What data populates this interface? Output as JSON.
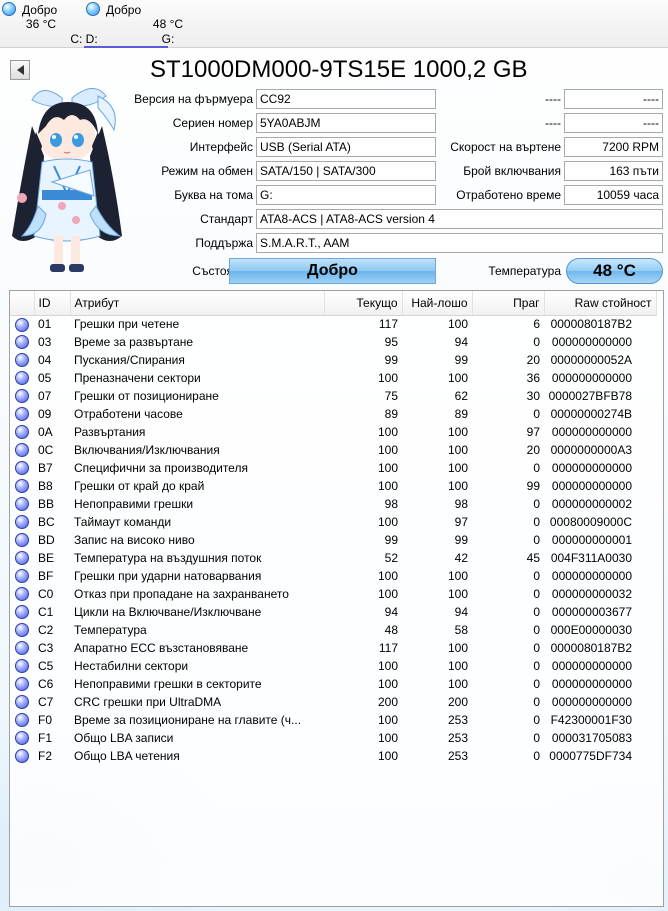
{
  "tabs": [
    {
      "status": "Добро",
      "temp": "36 °C",
      "drives": "C: D:"
    },
    {
      "status": "Добро",
      "temp": "48 °C",
      "drives": "G:"
    }
  ],
  "disk_title": "ST1000DM000-9TS15E 1000,2 GB",
  "labels": {
    "firmware": "Версия на фърмуера",
    "serial": "Сериен номер",
    "interface": "Интерфейс",
    "transfer": "Режим на обмен",
    "drive_letter": "Буква на тома",
    "standard": "Стандарт",
    "features": "Поддържа",
    "health": "Състояние",
    "rotation": "Скорост на въртене",
    "power_count": "Брой включвания",
    "power_hours": "Отработено време",
    "temperature": "Температура"
  },
  "values": {
    "firmware": "CC92",
    "serial": "5YA0ABJM",
    "interface": "USB (Serial ATA)",
    "transfer": "SATA/150 | SATA/300",
    "drive_letter": "G:",
    "standard": "ATA8-ACS | ATA8-ACS version 4",
    "features": "S.M.A.R.T., AAM",
    "top_right_label_1": "----",
    "top_right_value_1": "----",
    "top_right_label_2": "----",
    "top_right_value_2": "----",
    "rotation": "7200 RPM",
    "power_count": "163 пъти",
    "power_hours": "10059 часа",
    "health": "Добро",
    "temperature": "48 °C"
  },
  "table": {
    "headers": [
      "ID",
      "Атрибут",
      "Текущо",
      "Най-лошо",
      "Праг",
      "Raw стойност"
    ],
    "rows": [
      [
        "01",
        "Грешки при четене",
        "117",
        "100",
        "6",
        "000008018 7B2"
      ],
      [
        "03",
        "Време за развъртане",
        "95",
        "94",
        "0",
        "000000000000"
      ],
      [
        "04",
        "Пускания/Спирания",
        "99",
        "99",
        "20",
        "00000000052A"
      ],
      [
        "05",
        "Преназначени сектори",
        "100",
        "100",
        "36",
        "000000000000"
      ],
      [
        "07",
        "Грешки от позициониране",
        "75",
        "62",
        "30",
        "0000027BFB78"
      ],
      [
        "09",
        "Отработени часове",
        "89",
        "89",
        "0",
        "00000000274B"
      ],
      [
        "0A",
        "Развъртания",
        "100",
        "100",
        "97",
        "000000000000"
      ],
      [
        "0C",
        "Включвания/Изключвания",
        "100",
        "100",
        "20",
        "0000000000A3"
      ],
      [
        "B7",
        "Специфични за производителя",
        "100",
        "100",
        "0",
        "000000000000"
      ],
      [
        "B8",
        "Грешки от край до край",
        "100",
        "100",
        "99",
        "000000000000"
      ],
      [
        "BB",
        "Непоправими грешки",
        "98",
        "98",
        "0",
        "000000000002"
      ],
      [
        "BC",
        "Таймаут команди",
        "100",
        "97",
        "0",
        "00080009000C"
      ],
      [
        "BD",
        "Запис на високо ниво",
        "99",
        "99",
        "0",
        "000000000001"
      ],
      [
        "BE",
        "Температура на въздушния поток",
        "52",
        "42",
        "45",
        "004F311A0030"
      ],
      [
        "BF",
        "Грешки при ударни натоварвания",
        "100",
        "100",
        "0",
        "000000000000"
      ],
      [
        "C0",
        "Отказ при пропадане на захранването",
        "100",
        "100",
        "0",
        "000000000032"
      ],
      [
        "C1",
        "Цикли на Включване/Изключване",
        "94",
        "94",
        "0",
        "000000003677"
      ],
      [
        "C2",
        "Температура",
        "48",
        "58",
        "0",
        "000E00000030"
      ],
      [
        "C3",
        "Апаратно ECC възстановяване",
        "117",
        "100",
        "0",
        "0000080187B2"
      ],
      [
        "C5",
        "Нестабилни сектори",
        "100",
        "100",
        "0",
        "000000000000"
      ],
      [
        "C6",
        "Непоправими грешки в секторите",
        "100",
        "100",
        "0",
        "000000000000"
      ],
      [
        "C7",
        "CRC грешки при UltraDMA",
        "200",
        "200",
        "0",
        "000000000000"
      ],
      [
        "F0",
        "Време за позициониране на главите (ч...",
        "100",
        "253",
        "0",
        "F42300001F30"
      ],
      [
        "F1",
        "Общо LBA записи",
        "100",
        "253",
        "0",
        "000031705083"
      ],
      [
        "F2",
        "Общо LBA четения",
        "100",
        "253",
        "0",
        "0000775DF734"
      ]
    ]
  },
  "colors": {
    "status_dot": "#2e8fe0",
    "row_dot": "#3f55d8",
    "health_button": "#8ec8f3",
    "temp_button": "#93cdf5"
  }
}
